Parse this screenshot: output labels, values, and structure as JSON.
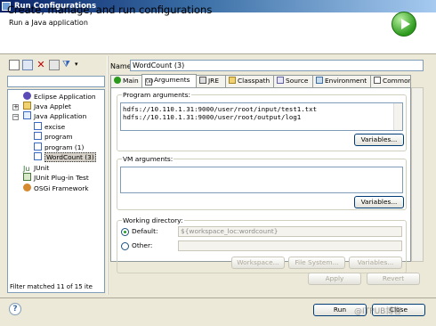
{
  "window": {
    "title": "Run Configurations"
  },
  "header": {
    "title": "Create, manage, and run configurations",
    "subtitle": "Run a Java application"
  },
  "filter": {
    "value": "",
    "status": "Filter matched 11 of 15 ite"
  },
  "tree": [
    {
      "label": "Eclipse Application",
      "icon": "eclipse-icon"
    },
    {
      "label": "Java Applet",
      "icon": "applet-icon"
    },
    {
      "label": "Java Application",
      "icon": "java-app-icon"
    },
    {
      "label": "excise",
      "icon": "java-config-icon"
    },
    {
      "label": "program",
      "icon": "java-config-icon"
    },
    {
      "label": "program (1)",
      "icon": "java-config-icon"
    },
    {
      "label": "WordCount (3)",
      "icon": "java-config-icon",
      "selected": true
    },
    {
      "label": "JUnit",
      "icon": "junit-icon"
    },
    {
      "label": "JUnit Plug-in Test",
      "icon": "junit-plugin-icon"
    },
    {
      "label": "OSGi Framework",
      "icon": "osgi-icon"
    }
  ],
  "config": {
    "name_label": "Name:",
    "name_value": "WordCount (3)",
    "tabs": [
      "Main",
      "Arguments",
      "JRE",
      "Classpath",
      "Source",
      "Environment",
      "Common"
    ],
    "active_tab": "Arguments",
    "program_args": {
      "label": "Program arguments:",
      "lines": [
        "hdfs://10.110.1.31:9000/user/root/input/test1.txt",
        "hdfs://10.110.1.31:9000/user/root/output/log1"
      ],
      "variables_button": "Variables..."
    },
    "vm_args": {
      "label": "VM arguments:",
      "value": "",
      "variables_button": "Variables..."
    },
    "working_dir": {
      "label": "Working directory:",
      "default_label": "Default:",
      "default_value": "${workspace_loc:wordcount}",
      "default_selected": true,
      "other_label": "Other:",
      "other_value": "",
      "buttons": [
        "Workspace...",
        "File System...",
        "Variables..."
      ]
    },
    "apply_button": "Apply",
    "revert_button": "Revert"
  },
  "footer": {
    "run_button": "Run",
    "close_button": "Close"
  },
  "watermark": "@ITPUB博客"
}
